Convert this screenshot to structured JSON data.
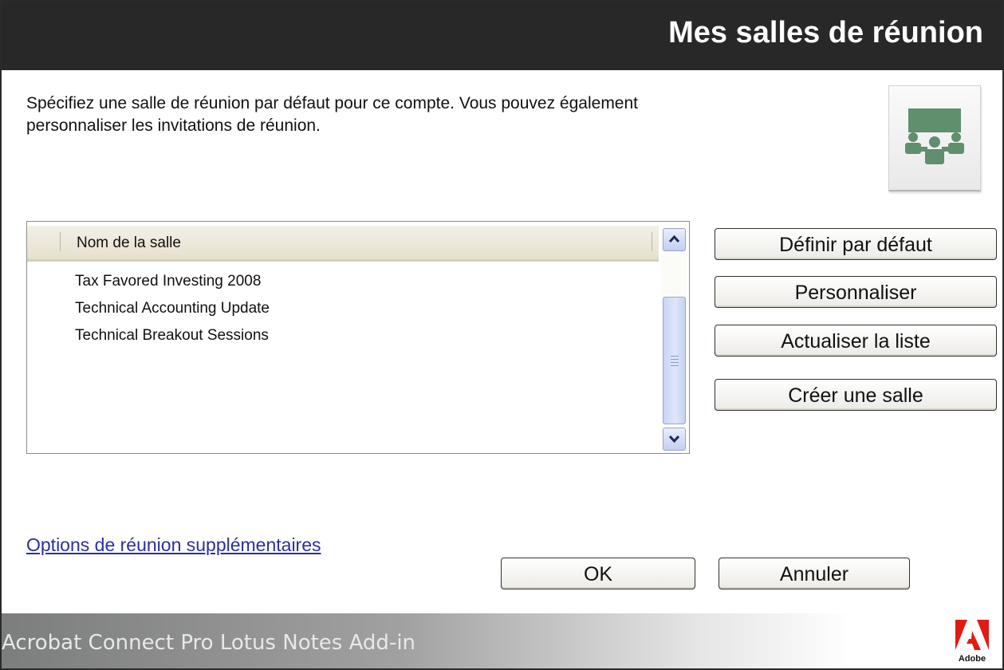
{
  "header": {
    "title": "Mes salles de réunion"
  },
  "description": "Spécifiez une salle de réunion par défaut pour ce compte.  Vous pouvez également personnaliser les invitations de réunion.",
  "room_list": {
    "column_header": "Nom de la salle",
    "rows": [
      "Tax Favored Investing 2008",
      "Technical Accounting Update",
      "Technical Breakout Sessions"
    ]
  },
  "side_buttons": {
    "set_default": "Définir par défaut",
    "customize": "Personnaliser",
    "refresh": "Actualiser la liste",
    "create_room": "Créer une salle"
  },
  "more_options_link": "Options de réunion supplémentaires",
  "dialog_buttons": {
    "ok": "OK",
    "cancel": "Annuler"
  },
  "footer": {
    "product": "Acrobat Connect Pro Lotus Notes Add-in",
    "brand": "Adobe"
  },
  "icons": {
    "room_icon": "meeting-room-icon",
    "scroll_up": "chevron-up-icon",
    "scroll_down": "chevron-down-icon",
    "logo": "adobe-logo-icon"
  },
  "colors": {
    "header_bg": "#282828",
    "room_icon_green": "#5f8f6d",
    "link": "#2b2fa0",
    "adobe_red": "#e01b12"
  }
}
